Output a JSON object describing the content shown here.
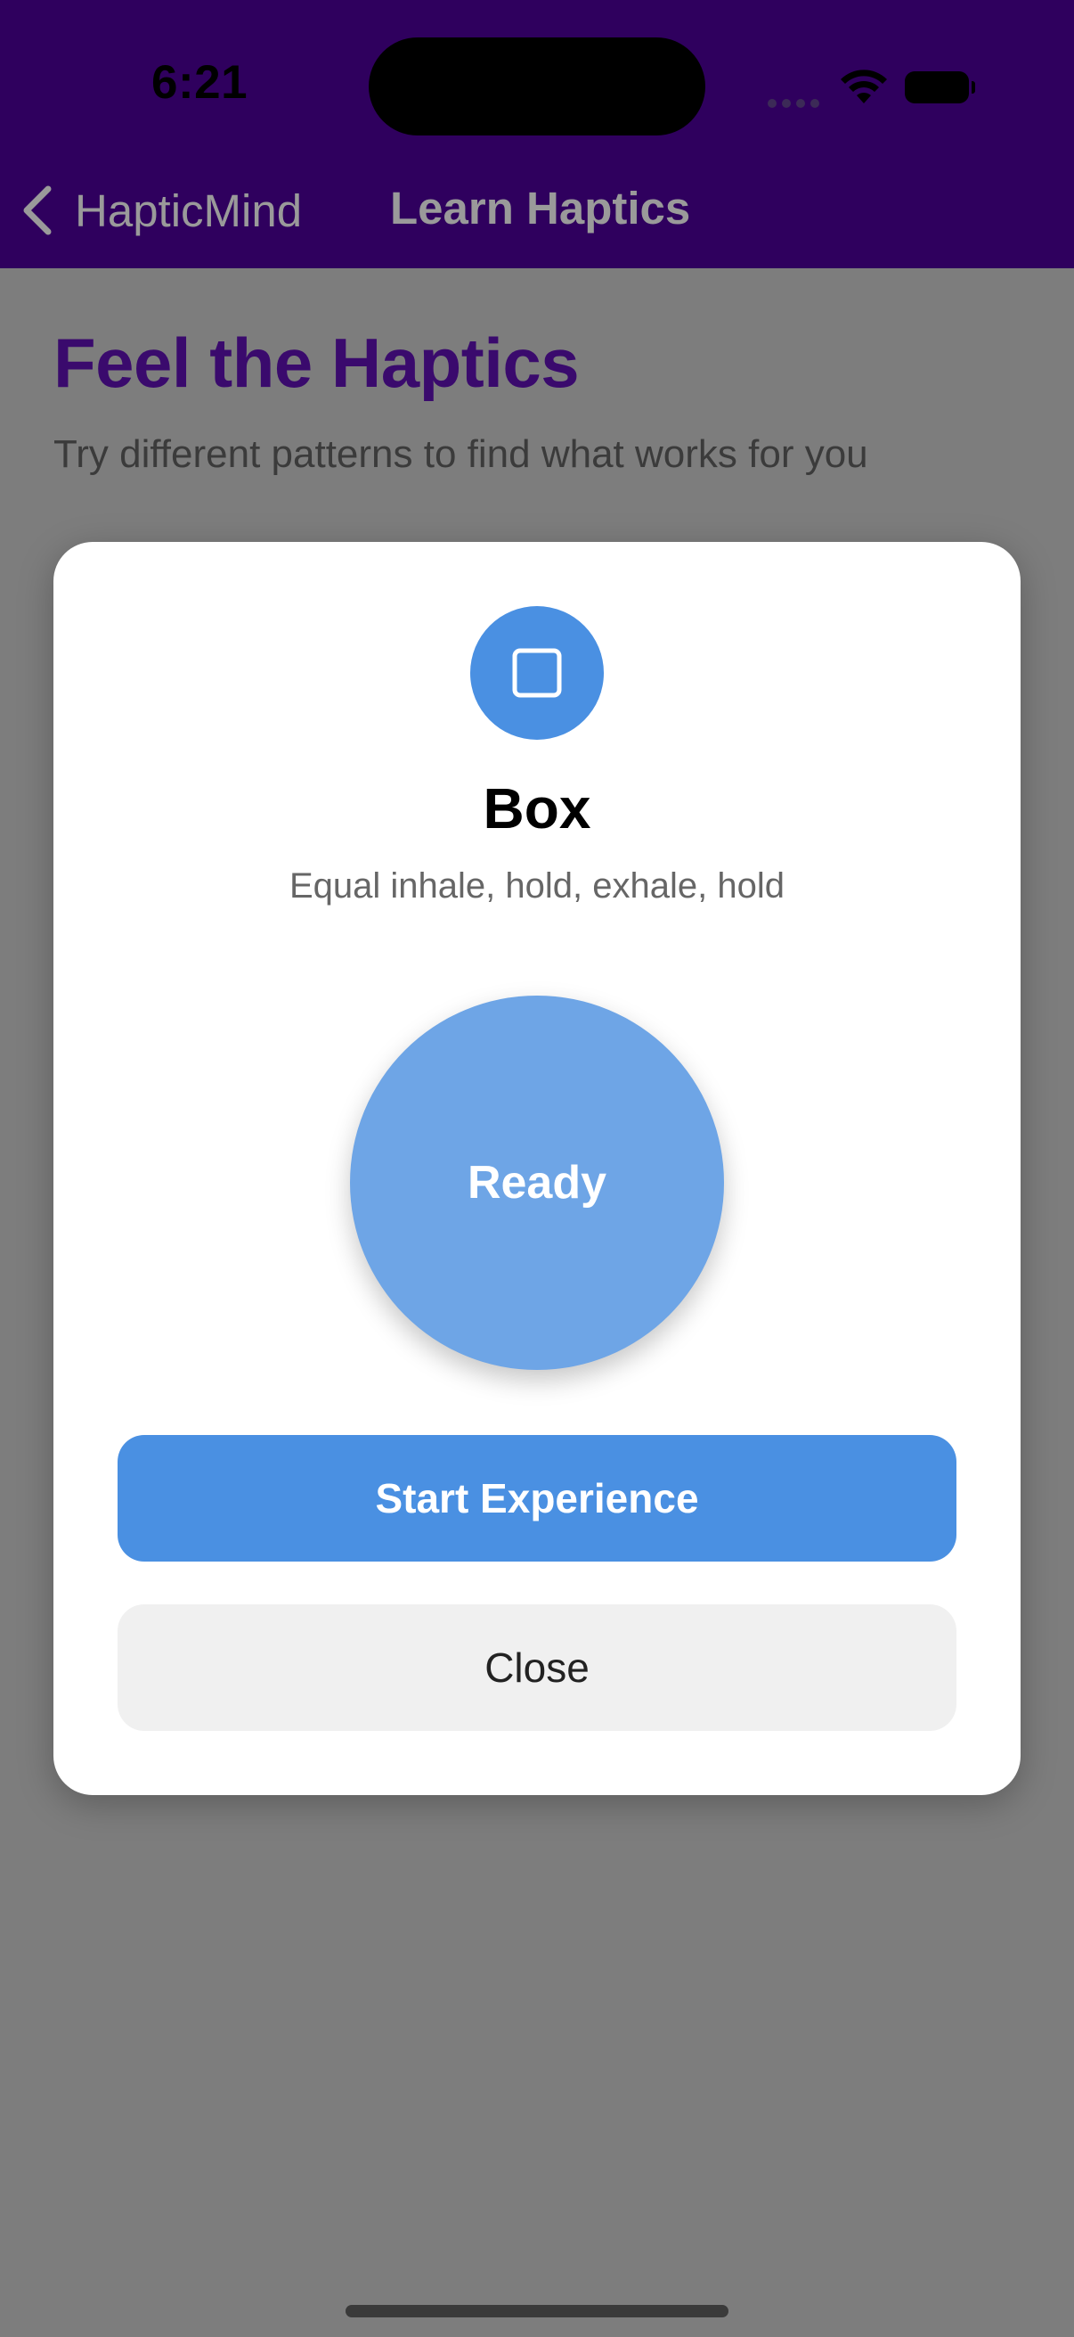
{
  "status_bar": {
    "time": "6:21"
  },
  "nav": {
    "back_label": "HapticMind",
    "title": "Learn Haptics"
  },
  "page": {
    "title": "Feel the Haptics",
    "subtitle": "Try different patterns to find what works for you"
  },
  "modal": {
    "icon": "square-icon",
    "pattern_name": "Box",
    "pattern_description": "Equal inhale, hold, exhale, hold",
    "breath_state": "Ready",
    "start_label": "Start Experience",
    "close_label": "Close"
  },
  "colors": {
    "nav_background": "#2f005e",
    "accent": "#4a90e2",
    "title_purple": "#3a0a6d"
  }
}
